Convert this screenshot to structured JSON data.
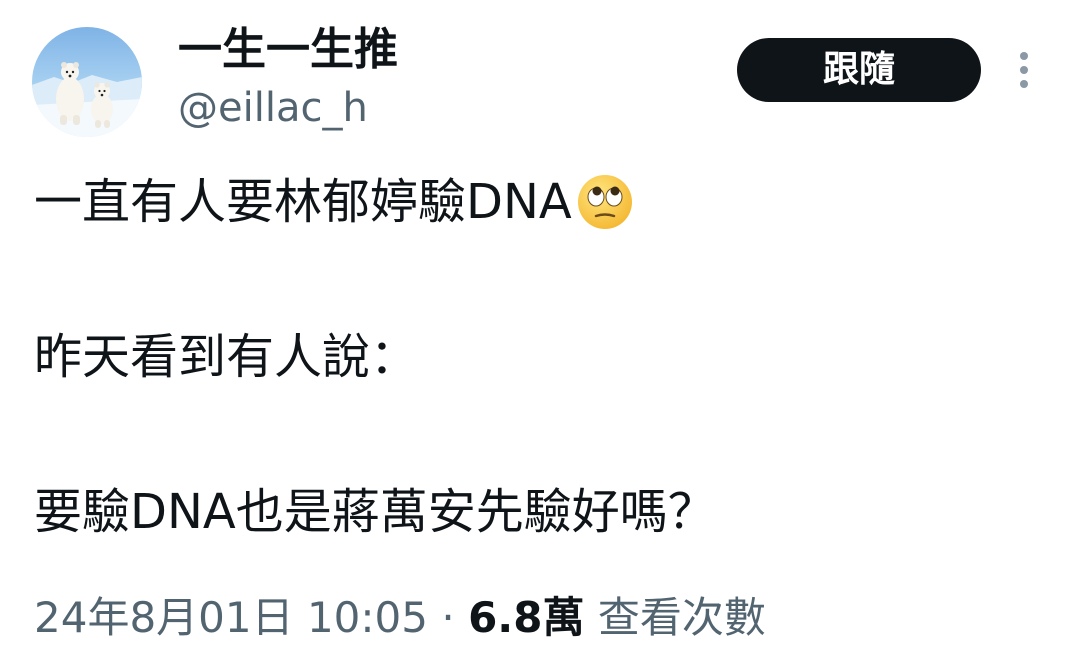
{
  "header": {
    "display_name": "一生一生推",
    "handle": "@eillac_h",
    "follow_label": "跟隨",
    "avatar_icon": "polar-bears-avatar",
    "more_icon": "more-vertical-icon"
  },
  "tweet": {
    "line1": "一直有人要林郁婷驗DNA",
    "line1_emoji": "face-with-rolling-eyes-emoji",
    "line2": "昨天看到有人說：",
    "line3": "要驗DNA也是蔣萬安先驗好嗎？"
  },
  "meta": {
    "timestamp": "24年8月01日 10:05",
    "separator": "·",
    "views_count": "6.8萬",
    "views_label": "查看次數"
  },
  "colors": {
    "text_primary": "#0f1419",
    "text_secondary": "#536471",
    "button_bg": "#0f1419",
    "button_text": "#ffffff"
  }
}
